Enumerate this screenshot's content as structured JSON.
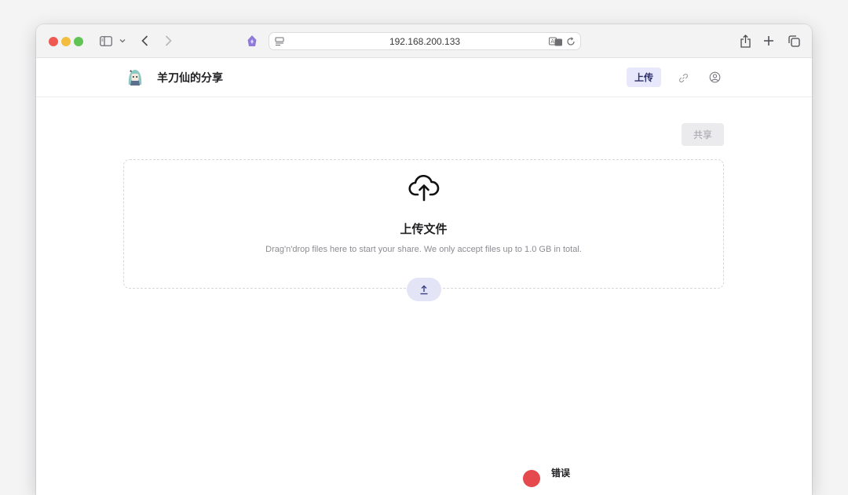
{
  "browser": {
    "url": "192.168.200.133",
    "icons": [
      "sidebar-icon",
      "chevron-down-icon",
      "back-icon",
      "forward-icon",
      "privacy-shield-icon",
      "page-menu-icon",
      "translate-icon",
      "reload-icon",
      "share-icon",
      "plus-icon",
      "tabs-overview-icon"
    ]
  },
  "header": {
    "site_title": "羊刀仙的分享",
    "upload_label": "上传"
  },
  "main": {
    "share_button": "共享",
    "dropzone": {
      "title": "上传文件",
      "description": "Drag'n'drop files here to start your share. We only accept files up to 1.0 GB in total."
    }
  },
  "toast": {
    "title": "错误"
  },
  "colors": {
    "accent": "#e7e8fb",
    "accent_text": "#2d2f66",
    "error": "#e5484d",
    "traffic_red": "#ee5a52",
    "traffic_yellow": "#f3bd40",
    "traffic_green": "#5fc454"
  }
}
